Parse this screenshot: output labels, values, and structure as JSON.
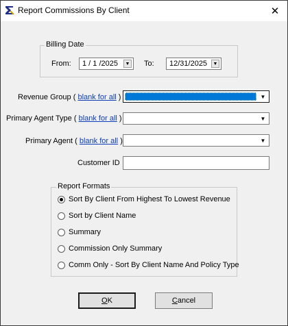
{
  "window": {
    "title": "Report Commissions By Client",
    "close_glyph": "✕",
    "icon": "sigma-icon"
  },
  "billing": {
    "legend": "Billing Date",
    "from_label": "From:",
    "from_value": "1 / 1 /2025",
    "to_label": "To:",
    "to_value": "12/31/2025"
  },
  "filters": {
    "revenue_group": {
      "label": "Revenue Group (",
      "link": "blank for all",
      "close": ")",
      "value": ""
    },
    "primary_agent_type": {
      "label": "Primary Agent Type (",
      "link": "blank for all",
      "close": ")",
      "value": ""
    },
    "primary_agent": {
      "label": "Primary Agent (",
      "link": "blank for all",
      "close": ")",
      "value": ""
    },
    "customer_id": {
      "label": "Customer ID",
      "value": ""
    }
  },
  "formats": {
    "legend": "Report Formats",
    "options": [
      {
        "label": "Sort By Client From Highest To Lowest Revenue",
        "checked": true
      },
      {
        "label": "Sort by Client Name",
        "checked": false
      },
      {
        "label": "Summary",
        "checked": false
      },
      {
        "label": "Commission Only Summary",
        "checked": false
      },
      {
        "label": "Comm Only - Sort By Client Name And Policy Type",
        "checked": false
      }
    ]
  },
  "buttons": {
    "ok_mnemonic": "O",
    "ok_rest": "K",
    "cancel_mnemonic": "C",
    "cancel_rest": "ancel"
  }
}
